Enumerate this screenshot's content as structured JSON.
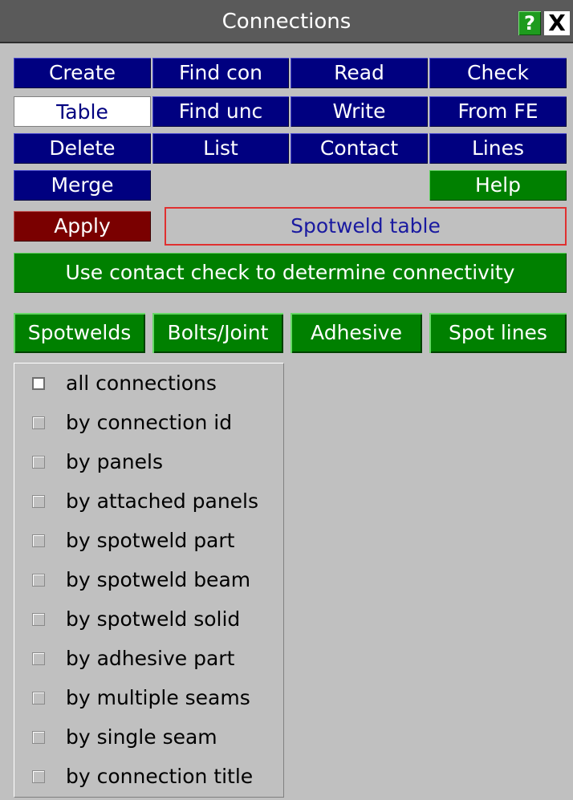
{
  "window": {
    "title": "Connections",
    "help_glyph": "?",
    "close_glyph": "X"
  },
  "menu": {
    "create": "Create",
    "find_con": "Find con",
    "read": "Read",
    "check": "Check",
    "table": "Table",
    "find_unc": "Find unc",
    "write": "Write",
    "from_fe": "From FE",
    "delete": "Delete",
    "list": "List",
    "contact": "Contact",
    "lines": "Lines",
    "merge": "Merge",
    "help": "Help"
  },
  "action": {
    "apply": "Apply",
    "mode_label": "Spotweld table",
    "contact_check": "Use contact check to determine connectivity"
  },
  "tabs": [
    "Spotwelds",
    "Bolts/Joint",
    "Adhesive",
    "Spot lines"
  ],
  "selection_options": [
    "all connections",
    "by connection id",
    "by panels",
    "by attached panels",
    "by spotweld part",
    "by spotweld beam",
    "by spotweld solid",
    "by adhesive part",
    "by multiple seams",
    "by single seam",
    "by connection title"
  ],
  "colors": {
    "button_navy": "#000080",
    "button_green": "#008000",
    "button_apply": "#7a0000",
    "panel_bg": "#c0c0c0",
    "titlebar": "#5a5a5a"
  }
}
